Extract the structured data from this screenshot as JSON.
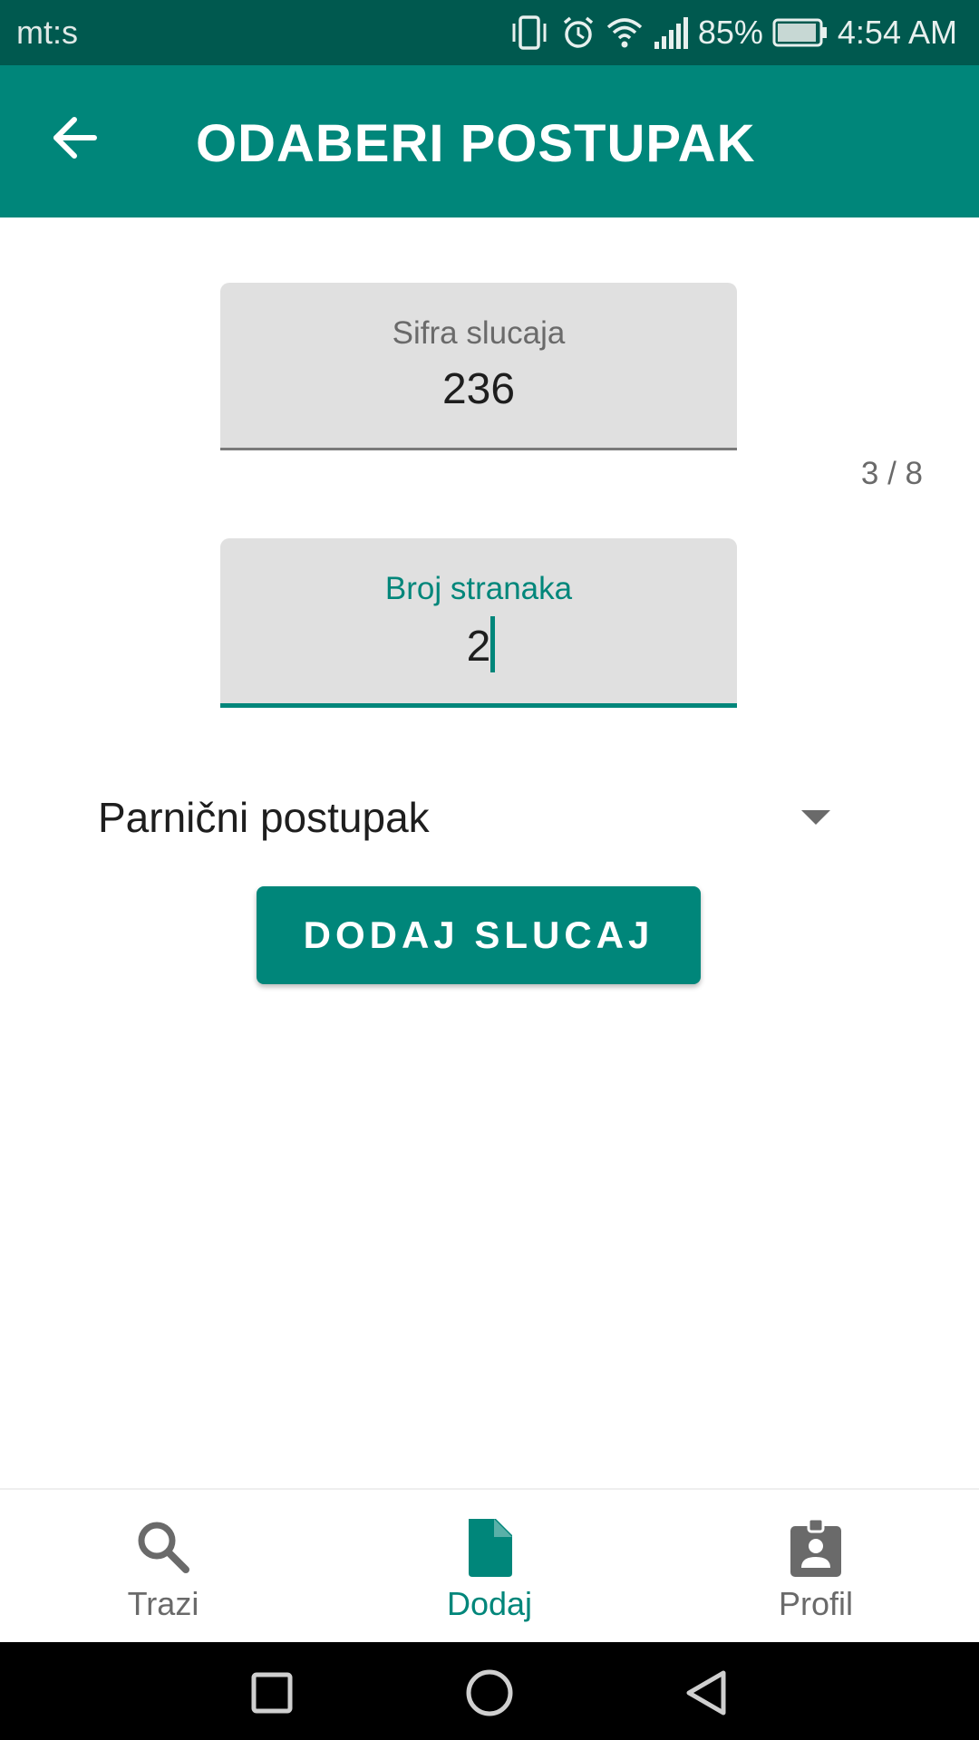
{
  "status_bar": {
    "carrier": "mt:s",
    "battery_percent": "85%",
    "time": "4:54 AM",
    "icons": [
      "vibrate-icon",
      "alarm-icon",
      "wifi-icon",
      "signal-icon",
      "battery-icon"
    ]
  },
  "app_bar": {
    "title": "ODABERI POSTUPAK",
    "back_icon": "arrow-back-icon"
  },
  "form": {
    "case_code": {
      "label": "Sifra slucaja",
      "value": "236"
    },
    "counter": "3 / 8",
    "party_count": {
      "label": "Broj stranaka",
      "value": "2"
    },
    "procedure_type": {
      "selected": "Parnični postupak"
    },
    "submit_label": "DODAJ SLUCAJ"
  },
  "bottom_nav": {
    "items": [
      {
        "label": "Trazi",
        "icon": "search-icon",
        "active": false
      },
      {
        "label": "Dodaj",
        "icon": "document-icon",
        "active": true
      },
      {
        "label": "Profil",
        "icon": "profile-badge-icon",
        "active": false
      }
    ]
  },
  "colors": {
    "primary": "#00867a",
    "primary_dark": "#00594f",
    "field_bg": "#e0e0e0",
    "inactive_nav": "#6a6a6a"
  }
}
